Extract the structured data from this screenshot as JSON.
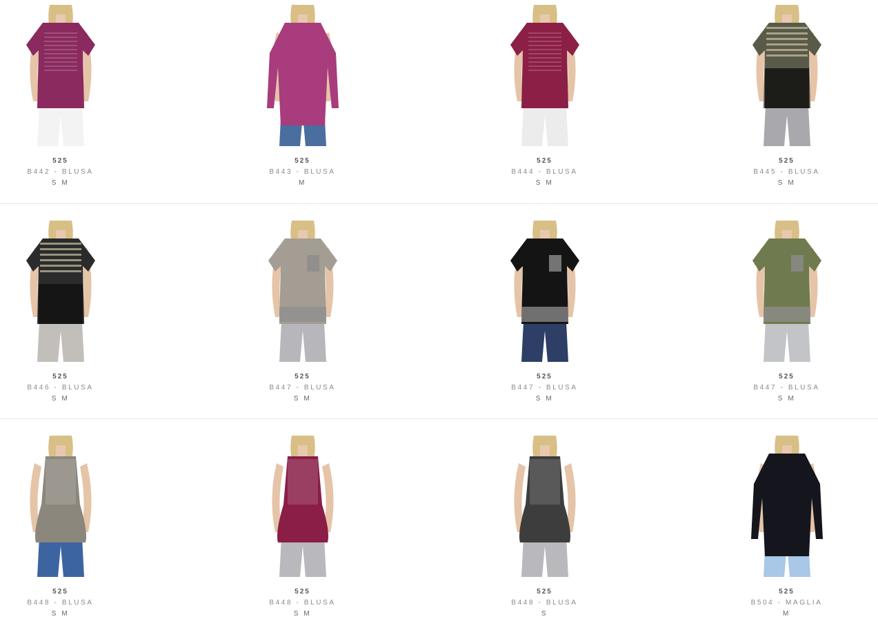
{
  "products": [
    {
      "price": "525",
      "name": "B442 - BLUSA",
      "sizes": "S M",
      "top_color": "#8a2a5e",
      "bottom_color": "#f3f3f3",
      "pattern": "sequin"
    },
    {
      "price": "525",
      "name": "B443 - BLUSA",
      "sizes": "M",
      "top_color": "#a83c7c",
      "bottom_color": "#4a6ea0",
      "pattern": "lace"
    },
    {
      "price": "525",
      "name": "B444 - BLUSA",
      "sizes": "S M",
      "top_color": "#8c1f46",
      "bottom_color": "#ececec",
      "pattern": "sequin-yoke"
    },
    {
      "price": "525",
      "name": "B445 - BLUSA",
      "sizes": "S M",
      "top_color": "#5a5a48",
      "bottom_color": "#a9a9ad",
      "pattern": "aztec"
    },
    {
      "price": "525",
      "name": "B446 - BLUSA",
      "sizes": "S M",
      "top_color": "#2b2b2b",
      "bottom_color": "#c2bfbb",
      "pattern": "aztec"
    },
    {
      "price": "525",
      "name": "B447 - BLUSA",
      "sizes": "S M",
      "top_color": "#a49d94",
      "bottom_color": "#b7b7bb",
      "pattern": "pocket"
    },
    {
      "price": "525",
      "name": "B447 - BLUSA",
      "sizes": "S M",
      "top_color": "#141414",
      "bottom_color": "#2d3f66",
      "pattern": "pocket"
    },
    {
      "price": "525",
      "name": "B447 - BLUSA",
      "sizes": "S M",
      "top_color": "#6f7a4e",
      "bottom_color": "#c2c4c8",
      "pattern": "pocket"
    },
    {
      "price": "525",
      "name": "B448 - BLUSA",
      "sizes": "S M",
      "top_color": "#8c877c",
      "bottom_color": "#3c64a0",
      "pattern": "cami"
    },
    {
      "price": "525",
      "name": "B448 - BLUSA",
      "sizes": "S M",
      "top_color": "#8a1e47",
      "bottom_color": "#b9b9bd",
      "pattern": "cami"
    },
    {
      "price": "525",
      "name": "B448 - BLUSA",
      "sizes": "S",
      "top_color": "#3d3d3d",
      "bottom_color": "#b9b9bd",
      "pattern": "cami"
    },
    {
      "price": "525",
      "name": "B504 - MAGLIA",
      "sizes": "M",
      "top_color": "#15161d",
      "bottom_color": "#a9c7e6",
      "pattern": "long-sleeve"
    }
  ]
}
